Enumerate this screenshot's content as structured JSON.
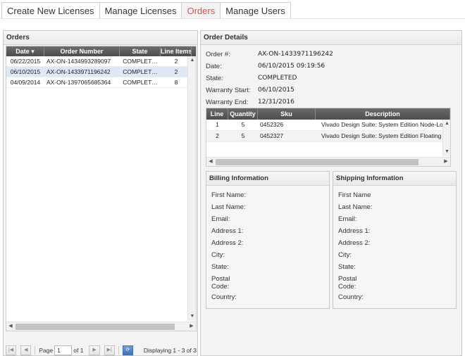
{
  "tabs": [
    {
      "label": "Create New Licenses"
    },
    {
      "label": "Manage Licenses"
    },
    {
      "label": "Orders"
    },
    {
      "label": "Manage Users"
    }
  ],
  "orders": {
    "title": "Orders",
    "columns": [
      "Date",
      "Order Number",
      "State",
      "Line Items"
    ],
    "rows": [
      {
        "date": "06/22/2015",
        "order": "AX-ON-1434993289097",
        "state": "COMPLET…",
        "items": "2"
      },
      {
        "date": "06/10/2015",
        "order": "AX-ON-1433971196242",
        "state": "COMPLET…",
        "items": "2"
      },
      {
        "date": "04/09/2014",
        "order": "AX-ON-1397065685364",
        "state": "COMPLET…",
        "items": "8"
      }
    ],
    "pager": {
      "page_label": "Page",
      "page_value": "1",
      "of_label": "of 1",
      "display_text": "Displaying 1 - 3 of 3"
    }
  },
  "details": {
    "title": "Order Details",
    "fields": [
      {
        "label": "Order #:",
        "value": "AX-ON-1433971196242"
      },
      {
        "label": "Date:",
        "value": "06/10/2015 09:19:56"
      },
      {
        "label": "State:",
        "value": "COMPLETED"
      },
      {
        "label": "Warranty Start:",
        "value": "06/10/2015"
      },
      {
        "label": "Warranty End:",
        "value": "12/31/2016"
      }
    ],
    "line_columns": [
      "Line",
      "Quantity",
      "Sku",
      "Description"
    ],
    "lines": [
      {
        "line": "1",
        "qty": "5",
        "sku": "0452326",
        "desc": "Vivado Design Suite: System Edition Node-Locked"
      },
      {
        "line": "2",
        "qty": "5",
        "sku": "0452327",
        "desc": "Vivado Design Suite: System Edition Floating (Serv"
      }
    ]
  },
  "billing": {
    "title": "Billing Information",
    "labels": [
      "First Name:",
      "Last Name:",
      "Email:",
      "Address 1:",
      "Address 2:",
      "City:",
      "State:",
      "Postal\nCode:",
      "Country:"
    ]
  },
  "shipping": {
    "title": "Shipping Information",
    "labels": [
      "First Name",
      "Last Name:",
      "Email:",
      "Address 1:",
      "Address 2:",
      "City:",
      "State:",
      "Postal\nCode:",
      "Country:"
    ]
  },
  "colors": {
    "accent": "#d9534f",
    "header": "#5a5a5a",
    "selected_row": "#dfe8f6"
  }
}
